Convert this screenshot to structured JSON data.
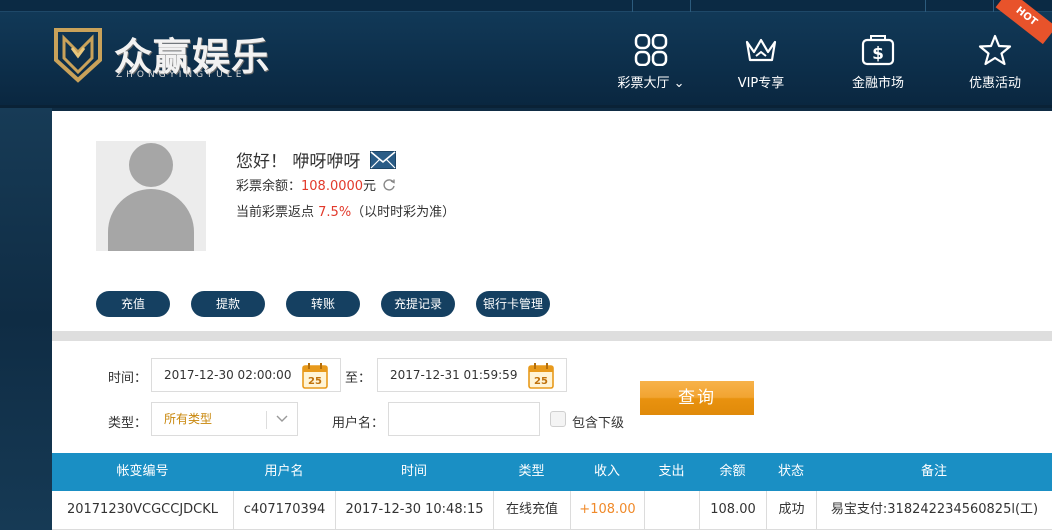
{
  "brand": {
    "title": "众赢娱乐",
    "subtitle": "ZHONGYINGYULE"
  },
  "nav": [
    {
      "label": "彩票大厅",
      "icon": "grid-icon"
    },
    {
      "label": "VIP专享",
      "icon": "crown-icon"
    },
    {
      "label": "金融市场",
      "icon": "dollar-bag-icon"
    },
    {
      "label": "优惠活动",
      "icon": "star-icon",
      "badge": "HOT"
    }
  ],
  "profile": {
    "greeting": "您好！ 咿呀咿呀",
    "balance_label": "彩票余额：",
    "balance_value": "108.0000",
    "balance_unit": "元",
    "rebate_label": "当前彩票返点 ",
    "rebate_value": "7.5%",
    "rebate_note": "（以时时彩为准）"
  },
  "actions": [
    "充值",
    "提款",
    "转账",
    "充提记录",
    "银行卡管理"
  ],
  "filter": {
    "time_label": "时间：",
    "time_start": "2017-12-30 02:00:00",
    "to_label": "至：",
    "time_end": "2017-12-31 01:59:59",
    "calendar_day": "25",
    "type_label": "类型：",
    "type_value": "所有类型",
    "username_label": "用户名：",
    "username_value": "",
    "include_sub_label": "包含下级",
    "include_sub_checked": false,
    "query_label": "查询"
  },
  "table": {
    "columns": [
      "帐变编号",
      "用户名",
      "时间",
      "类型",
      "收入",
      "支出",
      "余额",
      "状态",
      "备注"
    ],
    "rows": [
      [
        "20171230VCGCCJDCKL",
        "c407170394",
        "2017-12-30 10:48:15",
        "在线充值",
        "+108.00",
        "",
        "108.00",
        "成功",
        "易宝支付:318242234560825l(工)"
      ]
    ]
  },
  "colors": {
    "header_bg": "#0d2f4b",
    "pill_bg": "#154061",
    "table_head": "#1a8fc4",
    "query_btn": "#f2a431",
    "accent_red": "#e23a2c",
    "income_orange": "#f08a2a"
  }
}
